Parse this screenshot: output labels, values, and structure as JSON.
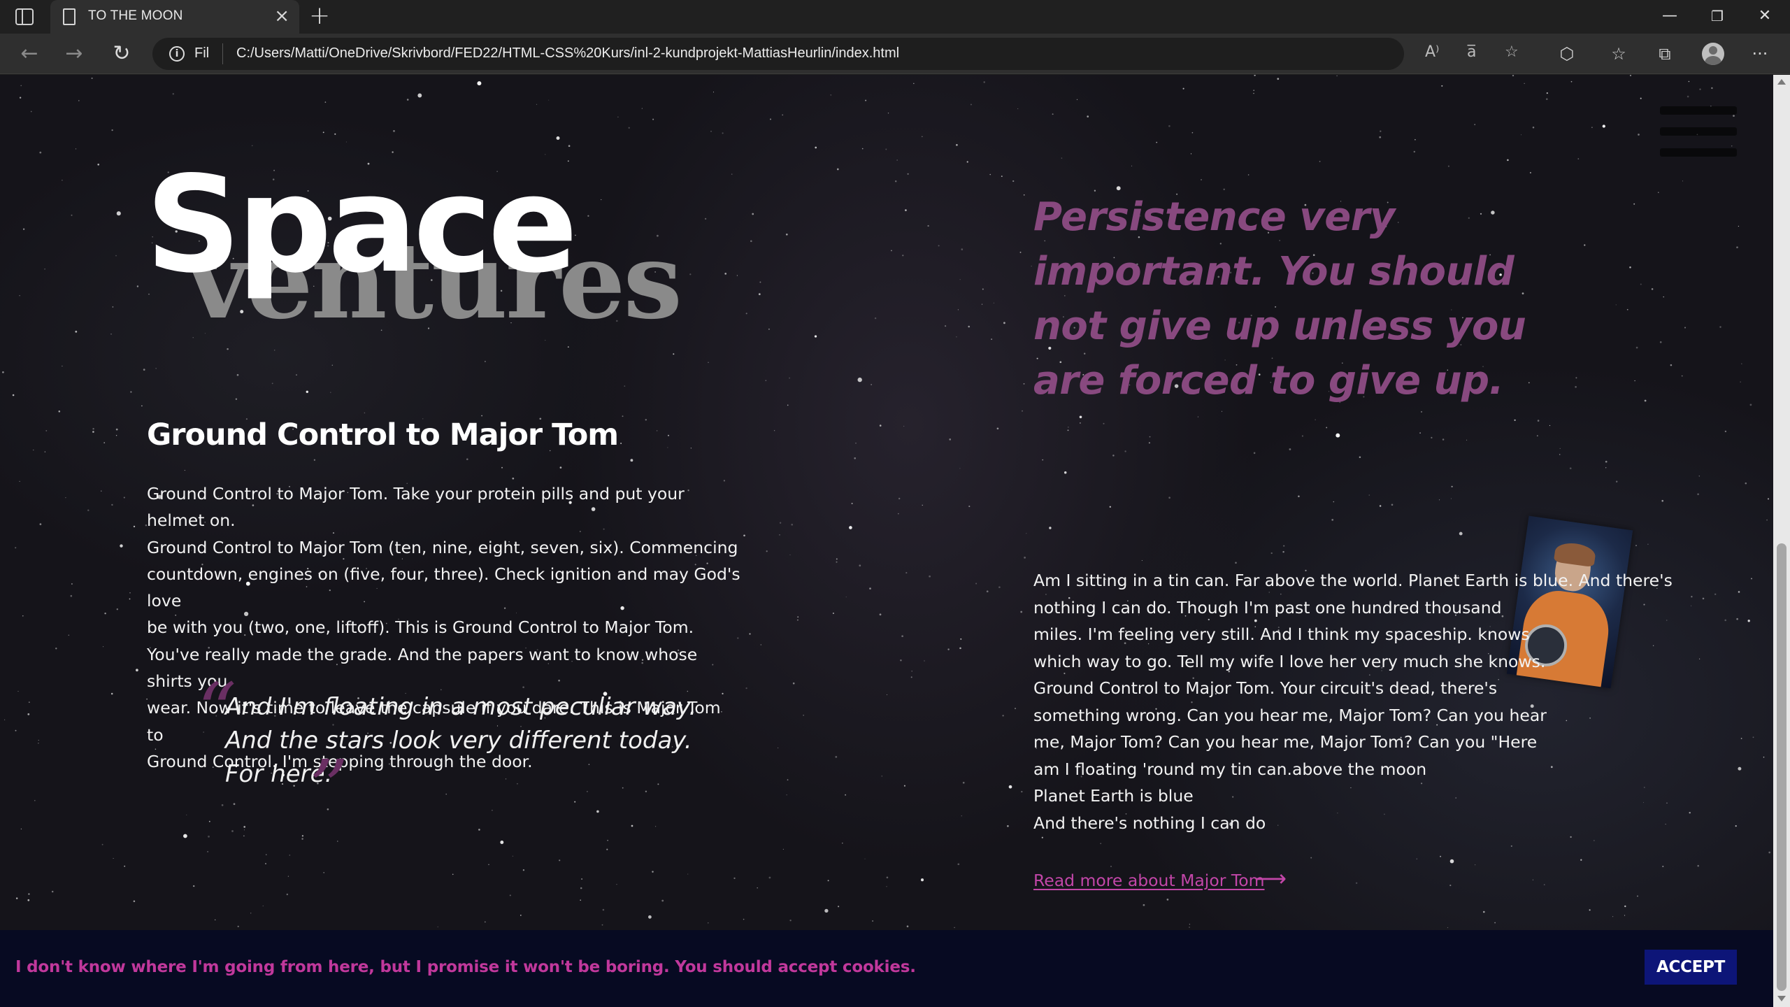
{
  "browser": {
    "tab_title": "TO THE MOON",
    "tab_close": "×",
    "new_tab": "+",
    "address_prefix": "Fil",
    "url": "C:/Users/Matti/OneDrive/Skrivbord/FED22/HTML-CSS%20Kurs/inl-2-kundprojekt-MattiasHeurlin/index.html",
    "back": "←",
    "forward": "→",
    "reload": "↻",
    "minimize": "—",
    "restore": "❐",
    "close": "✕",
    "more": "···",
    "read_aloud_icon": "A⁾",
    "translate_icon": "a̅",
    "add_fav_icon": "☆",
    "extensions_icon": "⬡",
    "favorites_icon": "☆",
    "collections_icon": "⧉"
  },
  "logo": {
    "top": "Space",
    "bottom": "ventures"
  },
  "left": {
    "heading": "Ground Control to Major Tom",
    "paragraph_lines": [
      "Ground Control to Major Tom. Take your protein pills and put your helmet on.",
      "Ground Control to Major Tom (ten, nine, eight, seven, six). Commencing",
      "countdown, engines on (five, four, three). Check ignition and may God's love",
      "be with you (two, one, liftoff). This is Ground Control to Major Tom.",
      "You've really made the grade. And the papers want to know whose shirts you",
      "wear. Now it's time to leave the capsule if you dare. This is Major Tom to",
      "Ground Control. I'm stepping through the door."
    ],
    "quote_lines": [
      "And I'm floating in a most peculiar way.",
      "And the stars look very different today.",
      "For here."
    ],
    "quote_open": "“",
    "quote_close": "”"
  },
  "right": {
    "big_quote_lines": [
      "Persistence very",
      "important. You should",
      "not give up unless you",
      "are forced to give up."
    ],
    "paragraph_lines": [
      "Am I sitting in a tin can. Far above the world. Planet Earth is blue. And there's",
      "nothing I can do. Though I'm past one hundred thousand",
      "miles. I'm feeling very still. And I think my spaceship. knows",
      "which way to go. Tell my wife I love her very much she knows.",
      "Ground Control to Major Tom. Your circuit's dead, there's",
      "something wrong. Can you hear me, Major Tom? Can you hear",
      "me, Major Tom? Can you hear me, Major Tom? Can you \"Here",
      "am I floating 'round my tin can.above the moon",
      "Planet Earth is blue",
      "And there's nothing I can do"
    ],
    "link_text": "Read more about Major Tom",
    "link_arrow": "⟶"
  },
  "cookie": {
    "message": "I don't know where I'm going from here, but I promise it won't be boring. You should accept cookies.",
    "accept_label": "ACCEPT"
  },
  "colors": {
    "accent_pink": "#c246a8",
    "quote_purple": "#88497f",
    "button_navy": "#0d1578",
    "cookie_bg": "#070a22"
  }
}
